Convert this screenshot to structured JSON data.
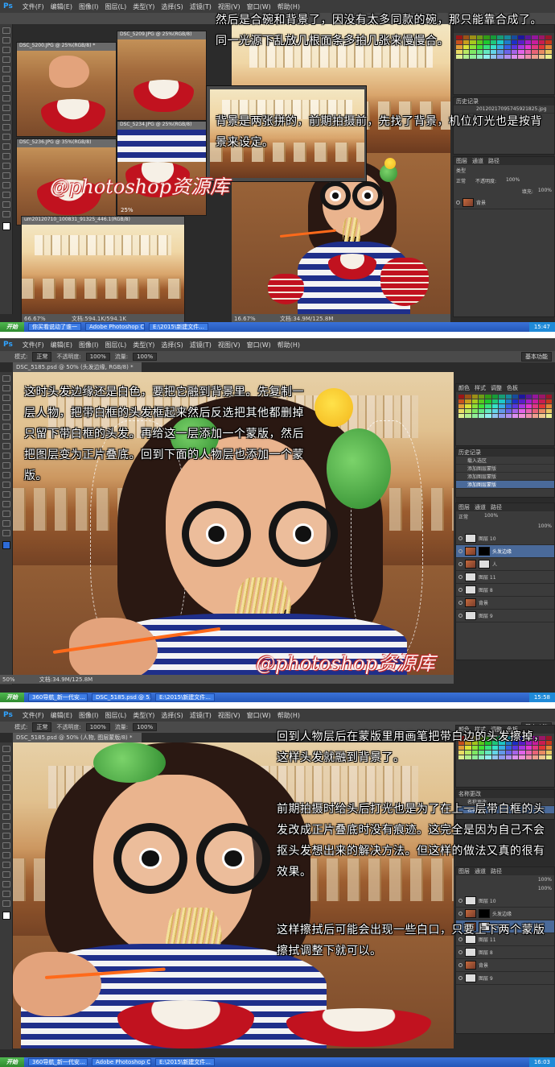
{
  "common": {
    "ps_logo": "Ps",
    "menu": [
      "文件(F)",
      "编辑(E)",
      "图像(I)",
      "图层(L)",
      "类型(Y)",
      "选择(S)",
      "滤镜(T)",
      "视图(V)",
      "窗口(W)",
      "帮助(H)"
    ],
    "start_label": "开始",
    "watermark": "@photoshop资源库"
  },
  "panel1": {
    "doc_tabs": [
      "DSC_5209.JPG @ 25%(RGB/8)",
      "DSC_5200.JPG @ 25%(RGB/8) *",
      "DSC_5236.JPG @ 35%(RGB/8)",
      "DSC_5234.JPG @ 25%(RGB/8)",
      "um20120710_100831_91325_446.1(RGB/8)"
    ],
    "status_left": "66.67%",
    "status_doc": "文档:594.1K/594.1K",
    "status_main_zoom": "16.67%",
    "status_main_doc": "文档:34.9M/125.8M",
    "sub_zoom": "25%",
    "history_label": "历史记录",
    "history_file": "20120217095745921825.jpg",
    "layers_tabs": [
      "图层",
      "通道",
      "路径"
    ],
    "layer_kind": "类型",
    "layer_mode": "正常",
    "opacity_label": "不透明度:",
    "opacity_value": "100%",
    "fill_label": "填充:",
    "fill_value": "100%",
    "bg_layer": "背景",
    "annotation_1": "然后是合碗和背景了，因没有太多同款的碗，那只能靠合成了。同一光源下乱放几根面条多拍几张来慢慢合。",
    "annotation_2": "背景是两张拼的，前期拍摄前，先找了背景，机位灯光也是按背景来设定。",
    "clock": "15:47"
  },
  "panel2": {
    "options": [
      "模式:",
      "正常",
      "不透明度:",
      "100%",
      "流量:",
      "100%"
    ],
    "doc_tab": "DSC_5185.psd @ 50% (头发边缘, RGB/8) *",
    "workspace": "基本功能",
    "status_zoom": "50%",
    "status_doc": "文档:34.9M/125.8M",
    "swatch_tabs": [
      "颜色",
      "样式",
      "调整",
      "色板"
    ],
    "history_label": "历史记录",
    "history_items": [
      "载入选区",
      "添加图层蒙版",
      "添加图层蒙版",
      "添加图层蒙版"
    ],
    "layers_tabs": [
      "图层",
      "通道",
      "路径"
    ],
    "layer_mode": "正常",
    "opacity_value": "100%",
    "fill_value": "100%",
    "layers": [
      "图层 10",
      "头发边缘",
      "人",
      "图层 11",
      "图层 8",
      "背景",
      "图层 9"
    ],
    "annotation": "这时头发边缘还是白色，要把它融到背景里。先复制一层人物，把带白框的头发框起来然后反选把其他都删掉只留下带白框的头发。再给这一层添加一个蒙版，然后把图层变为正片叠底。回到下面的人物层也添加一个蒙版。",
    "taskbar_tasks": [
      "360导航_新一代安...",
      "DSC_5185.psd @ 5...",
      "E:\\2015\\新建文件..."
    ],
    "clock": "15:58"
  },
  "panel3": {
    "options": [
      "模式:",
      "正常",
      "不透明度:",
      "100%",
      "流量:",
      "100%"
    ],
    "doc_tab": "DSC_5185.psd @ 50% (人物, 图层蒙版/8) *",
    "workspace": "基本功能",
    "swatch_tabs": [
      "颜色",
      "样式",
      "调整",
      "色板"
    ],
    "history_label": "名称更改",
    "history_items": [
      "名称更改",
      "名称更改"
    ],
    "layers_tabs": [
      "图层",
      "通道",
      "路径"
    ],
    "opacity_value": "100%",
    "fill_value": "100%",
    "layers": [
      "图层 10",
      "头发边缘",
      "人物",
      "图层 11",
      "图层 8",
      "背景",
      "图层 9"
    ],
    "annotation_1": "回到人物层后在蒙版里用画笔把带白边的头发擦掉，这样头发就融到背景了。",
    "annotation_2": "前期拍摄时给头后打光也是为了在上一层带白框的头发改成正片叠底时没有痕迹。这完全是因为自己不会抠头发想出来的解决方法。但这样的做法又真的很有效果。",
    "annotation_3": "这样擦拭后可能会出现一些白口，只要上下两个蒙版擦拭调整下就可以。",
    "taskbar_tasks": [
      "360导航_新一代安...",
      "Adobe Photoshop CS6",
      "E:\\2015\\新建文件..."
    ],
    "clock": "16:03"
  },
  "panel1_taskbar": [
    "你买看说动了谁一",
    "Adobe Photoshop CS6",
    "E:\\2015\\新建文件..."
  ],
  "colors": {
    "ps_bg": "#2b2b2b",
    "accent_blue": "#2d6bd8",
    "bowl_red": "#c1121f",
    "shirt_navy": "#1f2f8a",
    "chopstick_orange": "#ff6a1a"
  }
}
